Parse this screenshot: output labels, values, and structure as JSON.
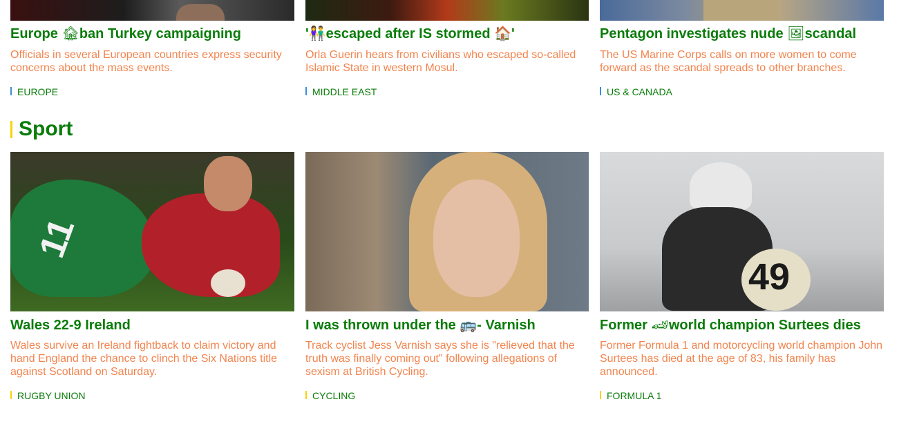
{
  "top_row": [
    {
      "headline_before": "Europe ",
      "emoji": "🏚",
      "headline_after": "ban Turkey campaigning",
      "summary": "Officials in several European countries express security concerns about the mass events.",
      "tag": "EUROPE",
      "tag_color": "#3a8fd6"
    },
    {
      "headline_before": "'",
      "emoji": "👫",
      "headline_after": "escaped after IS stormed 🏠'",
      "summary": "Orla Guerin hears from civilians who escaped so-called Islamic State in western Mosul.",
      "tag": "MIDDLE EAST",
      "tag_color": "#3a8fd6"
    },
    {
      "headline_before": "Pentagon investigates nude ",
      "emoji": "🖼",
      "headline_after": "scandal",
      "summary": "The US Marine Corps calls on more women to come forward as the scandal spreads to other branches.",
      "tag": "US & CANADA",
      "tag_color": "#3a8fd6"
    }
  ],
  "sport": {
    "title": "Sport",
    "stories": [
      {
        "headline_before": "Wales 22-9 Ireland",
        "emoji": "",
        "headline_after": "",
        "summary": "Wales survive an Ireland fightback to claim victory and hand England the chance to clinch the Six Nations title against Scotland on Saturday.",
        "tag": "RUGBY UNION",
        "tag_color": "#f5d300",
        "image_label": "11"
      },
      {
        "headline_before": "I was thrown under the ",
        "emoji": "🚌",
        "headline_after": "- Varnish",
        "summary": "Track cyclist Jess Varnish says she is \"relieved that the truth was finally coming out\" following allegations of sexism at British Cycling.",
        "tag": "CYCLING",
        "tag_color": "#f5d300"
      },
      {
        "headline_before": "Former ",
        "emoji": "🏎",
        "headline_after": "world champion Surtees dies",
        "summary": "Former Formula 1 and motorcycling world champion John Surtees has died at the age of 83, his family has announced.",
        "tag": "FORMULA 1",
        "tag_color": "#f5d300",
        "image_label": "49"
      }
    ]
  }
}
